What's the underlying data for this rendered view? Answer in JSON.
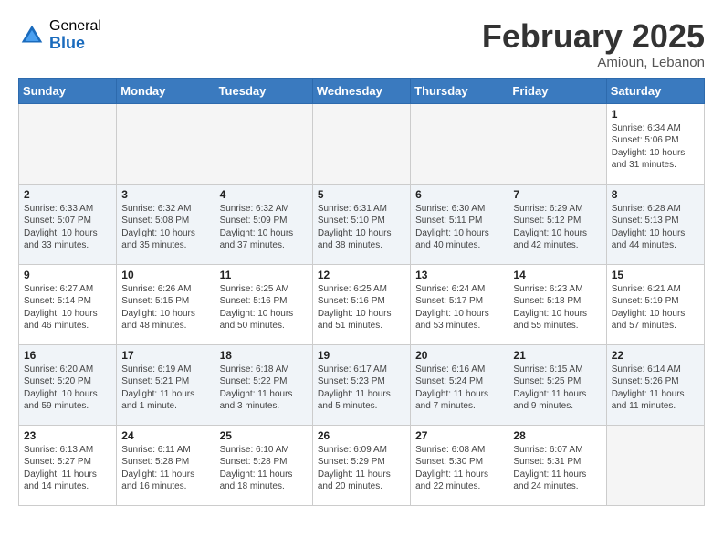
{
  "header": {
    "logo_general": "General",
    "logo_blue": "Blue",
    "month_year": "February 2025",
    "location": "Amioun, Lebanon"
  },
  "days_of_week": [
    "Sunday",
    "Monday",
    "Tuesday",
    "Wednesday",
    "Thursday",
    "Friday",
    "Saturday"
  ],
  "weeks": [
    [
      {
        "day": "",
        "info": ""
      },
      {
        "day": "",
        "info": ""
      },
      {
        "day": "",
        "info": ""
      },
      {
        "day": "",
        "info": ""
      },
      {
        "day": "",
        "info": ""
      },
      {
        "day": "",
        "info": ""
      },
      {
        "day": "1",
        "info": "Sunrise: 6:34 AM\nSunset: 5:06 PM\nDaylight: 10 hours and 31 minutes."
      }
    ],
    [
      {
        "day": "2",
        "info": "Sunrise: 6:33 AM\nSunset: 5:07 PM\nDaylight: 10 hours and 33 minutes."
      },
      {
        "day": "3",
        "info": "Sunrise: 6:32 AM\nSunset: 5:08 PM\nDaylight: 10 hours and 35 minutes."
      },
      {
        "day": "4",
        "info": "Sunrise: 6:32 AM\nSunset: 5:09 PM\nDaylight: 10 hours and 37 minutes."
      },
      {
        "day": "5",
        "info": "Sunrise: 6:31 AM\nSunset: 5:10 PM\nDaylight: 10 hours and 38 minutes."
      },
      {
        "day": "6",
        "info": "Sunrise: 6:30 AM\nSunset: 5:11 PM\nDaylight: 10 hours and 40 minutes."
      },
      {
        "day": "7",
        "info": "Sunrise: 6:29 AM\nSunset: 5:12 PM\nDaylight: 10 hours and 42 minutes."
      },
      {
        "day": "8",
        "info": "Sunrise: 6:28 AM\nSunset: 5:13 PM\nDaylight: 10 hours and 44 minutes."
      }
    ],
    [
      {
        "day": "9",
        "info": "Sunrise: 6:27 AM\nSunset: 5:14 PM\nDaylight: 10 hours and 46 minutes."
      },
      {
        "day": "10",
        "info": "Sunrise: 6:26 AM\nSunset: 5:15 PM\nDaylight: 10 hours and 48 minutes."
      },
      {
        "day": "11",
        "info": "Sunrise: 6:25 AM\nSunset: 5:16 PM\nDaylight: 10 hours and 50 minutes."
      },
      {
        "day": "12",
        "info": "Sunrise: 6:25 AM\nSunset: 5:16 PM\nDaylight: 10 hours and 51 minutes."
      },
      {
        "day": "13",
        "info": "Sunrise: 6:24 AM\nSunset: 5:17 PM\nDaylight: 10 hours and 53 minutes."
      },
      {
        "day": "14",
        "info": "Sunrise: 6:23 AM\nSunset: 5:18 PM\nDaylight: 10 hours and 55 minutes."
      },
      {
        "day": "15",
        "info": "Sunrise: 6:21 AM\nSunset: 5:19 PM\nDaylight: 10 hours and 57 minutes."
      }
    ],
    [
      {
        "day": "16",
        "info": "Sunrise: 6:20 AM\nSunset: 5:20 PM\nDaylight: 10 hours and 59 minutes."
      },
      {
        "day": "17",
        "info": "Sunrise: 6:19 AM\nSunset: 5:21 PM\nDaylight: 11 hours and 1 minute."
      },
      {
        "day": "18",
        "info": "Sunrise: 6:18 AM\nSunset: 5:22 PM\nDaylight: 11 hours and 3 minutes."
      },
      {
        "day": "19",
        "info": "Sunrise: 6:17 AM\nSunset: 5:23 PM\nDaylight: 11 hours and 5 minutes."
      },
      {
        "day": "20",
        "info": "Sunrise: 6:16 AM\nSunset: 5:24 PM\nDaylight: 11 hours and 7 minutes."
      },
      {
        "day": "21",
        "info": "Sunrise: 6:15 AM\nSunset: 5:25 PM\nDaylight: 11 hours and 9 minutes."
      },
      {
        "day": "22",
        "info": "Sunrise: 6:14 AM\nSunset: 5:26 PM\nDaylight: 11 hours and 11 minutes."
      }
    ],
    [
      {
        "day": "23",
        "info": "Sunrise: 6:13 AM\nSunset: 5:27 PM\nDaylight: 11 hours and 14 minutes."
      },
      {
        "day": "24",
        "info": "Sunrise: 6:11 AM\nSunset: 5:28 PM\nDaylight: 11 hours and 16 minutes."
      },
      {
        "day": "25",
        "info": "Sunrise: 6:10 AM\nSunset: 5:28 PM\nDaylight: 11 hours and 18 minutes."
      },
      {
        "day": "26",
        "info": "Sunrise: 6:09 AM\nSunset: 5:29 PM\nDaylight: 11 hours and 20 minutes."
      },
      {
        "day": "27",
        "info": "Sunrise: 6:08 AM\nSunset: 5:30 PM\nDaylight: 11 hours and 22 minutes."
      },
      {
        "day": "28",
        "info": "Sunrise: 6:07 AM\nSunset: 5:31 PM\nDaylight: 11 hours and 24 minutes."
      },
      {
        "day": "",
        "info": ""
      }
    ]
  ]
}
